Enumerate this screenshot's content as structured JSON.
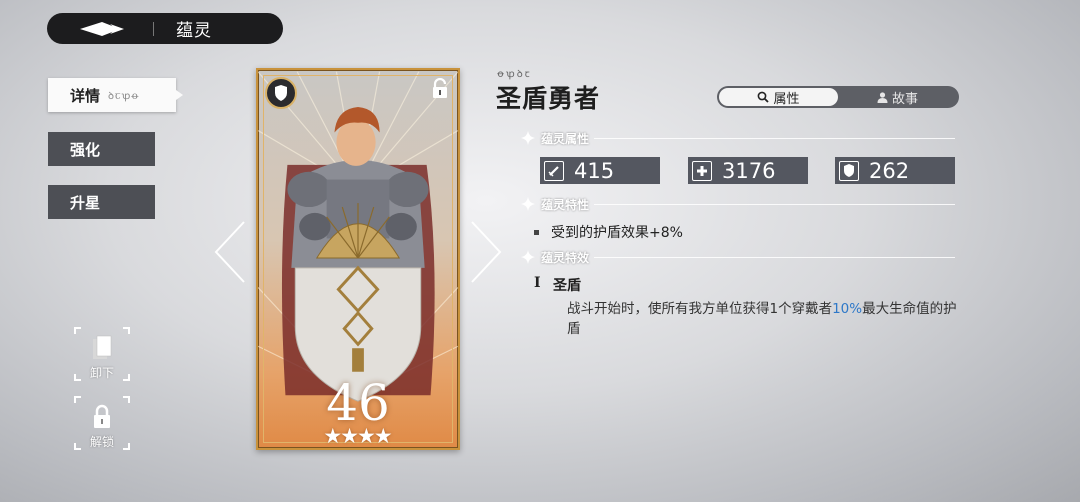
{
  "header": {
    "title": "蕴灵"
  },
  "tabs": [
    {
      "label": "详情",
      "sub": "ꝺꞇꝕꝋ"
    },
    {
      "label": "强化"
    },
    {
      "label": "升星"
    }
  ],
  "side_actions": [
    {
      "label": "卸下",
      "icon": "cards-icon"
    },
    {
      "label": "解锁",
      "icon": "lock-icon"
    }
  ],
  "card": {
    "level": "46",
    "stars": 4,
    "badge_icon": "shield-icon",
    "lock_icon": "lock-icon"
  },
  "character": {
    "glyphs": "ꝋꝕꝺꞇ",
    "name": "圣盾勇者"
  },
  "toggle": {
    "options": [
      "属性",
      "故事"
    ],
    "selected": "属性"
  },
  "sections": {
    "attributes": "蕴灵属性",
    "traits": "蕴灵特性",
    "effects": "蕴灵特效"
  },
  "stats": [
    {
      "icon": "sword-icon",
      "value": "415"
    },
    {
      "icon": "health-cross-icon",
      "value": "3176"
    },
    {
      "icon": "shield-icon",
      "value": "262"
    }
  ],
  "traits": [
    "受到的护盾效果+8%"
  ],
  "effect": {
    "index": "I",
    "name": "圣盾",
    "desc_before": "战斗开始时，使所有我方单位获得1个穿戴者",
    "desc_highlight": "10%",
    "desc_after": "最大生命值的护盾"
  },
  "colors": {
    "highlight": "#2e78c8",
    "card_gold": "#c8923c"
  }
}
